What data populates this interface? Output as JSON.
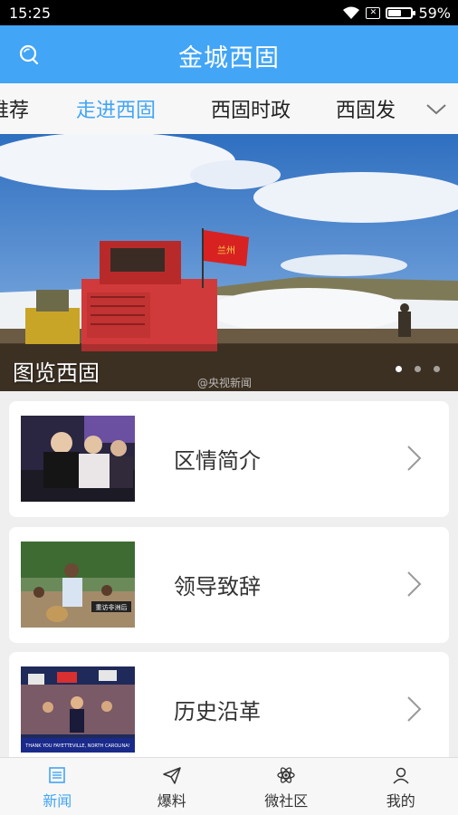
{
  "status_bar": {
    "time": "15:25",
    "battery": "59%",
    "battery_level": 0.59,
    "sim": "✕"
  },
  "header": {
    "title": "金城西固",
    "left_icon": "search-icon"
  },
  "tabs": [
    {
      "label": "推荐",
      "active": false
    },
    {
      "label": "走进西固",
      "active": true
    },
    {
      "label": "西固时政",
      "active": false
    },
    {
      "label": "西固发",
      "active": false
    }
  ],
  "tabs_more_icon": "chevron-down-icon",
  "banner": {
    "caption": "图览西固",
    "watermark": "@央视新闻",
    "flag_text": "兰州",
    "slides": 3,
    "active_slide": 1
  },
  "cards": [
    {
      "label": "区情简介"
    },
    {
      "label": "领导致辞",
      "thumb_text": "重访非洲后"
    },
    {
      "label": "历史沿革",
      "thumb_text": "THANK YOU FAYETTEVILLE, NORTH CAROLINA!"
    }
  ],
  "bottom_nav": [
    {
      "label": "新闻",
      "icon": "news-icon",
      "active": true
    },
    {
      "label": "爆料",
      "icon": "paper-plane-icon",
      "active": false
    },
    {
      "label": "微社区",
      "icon": "atom-icon",
      "active": false
    },
    {
      "label": "我的",
      "icon": "user-icon",
      "active": false
    }
  ],
  "colors": {
    "accent": "#42a5f5",
    "background": "#efefef",
    "status_bar": "#000000"
  }
}
